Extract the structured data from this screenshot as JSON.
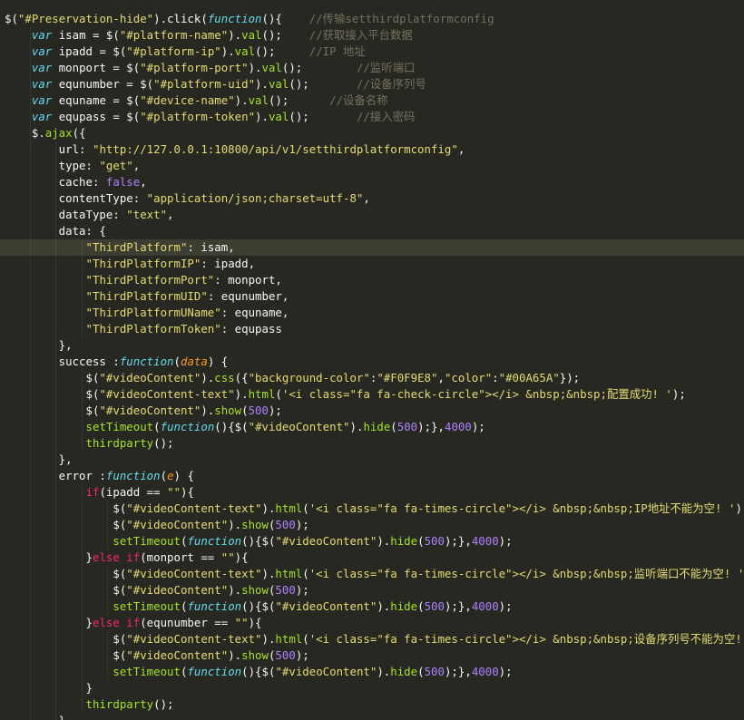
{
  "colors": {
    "background": "#272822",
    "current_line": "#3e3d32",
    "plain": "#f8f8f2",
    "string": "#e6db74",
    "keyword_italic": "#66d9ef",
    "function_call": "#a6e22e",
    "comment": "#75715e",
    "number": "#ae81ff",
    "control": "#f92672",
    "parameter": "#fd971f"
  },
  "code": {
    "current_line_index": 14,
    "lines": [
      [
        [
          "p",
          "$("
        ],
        [
          "s",
          "\"#Preservation-hide\""
        ],
        [
          "p",
          ").click("
        ],
        [
          "k",
          "function"
        ],
        [
          "p",
          "(){    "
        ],
        [
          "c",
          "//传输setthirdplatformconfig"
        ]
      ],
      [
        [
          "p",
          "    "
        ],
        [
          "k",
          "var"
        ],
        [
          "p",
          " isam = $("
        ],
        [
          "s",
          "\"#platform-name\""
        ],
        [
          "p",
          ")."
        ],
        [
          "f",
          "val"
        ],
        [
          "p",
          "();    "
        ],
        [
          "c",
          "//获取接入平台数据"
        ]
      ],
      [
        [
          "p",
          "    "
        ],
        [
          "k",
          "var"
        ],
        [
          "p",
          " ipadd = $("
        ],
        [
          "s",
          "\"#platform-ip\""
        ],
        [
          "p",
          ")."
        ],
        [
          "f",
          "val"
        ],
        [
          "p",
          "();     "
        ],
        [
          "c",
          "//IP 地址"
        ]
      ],
      [
        [
          "p",
          "    "
        ],
        [
          "k",
          "var"
        ],
        [
          "p",
          " monport = $("
        ],
        [
          "s",
          "\"#platform-port\""
        ],
        [
          "p",
          ")."
        ],
        [
          "f",
          "val"
        ],
        [
          "p",
          "();        "
        ],
        [
          "c",
          "//监听端口"
        ]
      ],
      [
        [
          "p",
          "    "
        ],
        [
          "k",
          "var"
        ],
        [
          "p",
          " equnumber = $("
        ],
        [
          "s",
          "\"#platform-uid\""
        ],
        [
          "p",
          ")."
        ],
        [
          "f",
          "val"
        ],
        [
          "p",
          "();       "
        ],
        [
          "c",
          "//设备序列号"
        ]
      ],
      [
        [
          "p",
          "    "
        ],
        [
          "k",
          "var"
        ],
        [
          "p",
          " equname = $("
        ],
        [
          "s",
          "\"#device-name\""
        ],
        [
          "p",
          ")."
        ],
        [
          "f",
          "val"
        ],
        [
          "p",
          "();      "
        ],
        [
          "c",
          "//设备名称"
        ]
      ],
      [
        [
          "p",
          "    "
        ],
        [
          "k",
          "var"
        ],
        [
          "p",
          " equpass = $("
        ],
        [
          "s",
          "\"#platform-token\""
        ],
        [
          "p",
          ")."
        ],
        [
          "f",
          "val"
        ],
        [
          "p",
          "();       "
        ],
        [
          "c",
          "//接入密码"
        ]
      ],
      [
        [
          "p",
          "    $."
        ],
        [
          "f",
          "ajax"
        ],
        [
          "p",
          "({"
        ]
      ],
      [
        [
          "p",
          "        url: "
        ],
        [
          "s",
          "\"http://127.0.0.1:10800/api/v1/setthirdplatformconfig\""
        ],
        [
          "p",
          ","
        ]
      ],
      [
        [
          "p",
          "        type: "
        ],
        [
          "s",
          "\"get\""
        ],
        [
          "p",
          ","
        ]
      ],
      [
        [
          "p",
          "        cache: "
        ],
        [
          "n",
          "false"
        ],
        [
          "p",
          ","
        ]
      ],
      [
        [
          "p",
          "        contentType: "
        ],
        [
          "s",
          "\"application/json;charset=utf-8\""
        ],
        [
          "p",
          ","
        ]
      ],
      [
        [
          "p",
          "        dataType: "
        ],
        [
          "s",
          "\"text\""
        ],
        [
          "p",
          ","
        ]
      ],
      [
        [
          "p",
          "        data: {"
        ]
      ],
      [
        [
          "p",
          "            "
        ],
        [
          "s",
          "\"ThirdPlatform\""
        ],
        [
          "p",
          ": isam,"
        ]
      ],
      [
        [
          "p",
          "            "
        ],
        [
          "s",
          "\"ThirdPlatformIP\""
        ],
        [
          "p",
          ": ipadd,"
        ]
      ],
      [
        [
          "p",
          "            "
        ],
        [
          "s",
          "\"ThirdPlatformPort\""
        ],
        [
          "p",
          ": monport,"
        ]
      ],
      [
        [
          "p",
          "            "
        ],
        [
          "s",
          "\"ThirdPlatformUID\""
        ],
        [
          "p",
          ": equnumber,"
        ]
      ],
      [
        [
          "p",
          "            "
        ],
        [
          "s",
          "\"ThirdPlatformUName\""
        ],
        [
          "p",
          ": equname,"
        ]
      ],
      [
        [
          "p",
          "            "
        ],
        [
          "s",
          "\"ThirdPlatformToken\""
        ],
        [
          "p",
          ": equpass"
        ]
      ],
      [
        [
          "p",
          "        },"
        ]
      ],
      [
        [
          "p",
          "        success :"
        ],
        [
          "k",
          "function"
        ],
        [
          "p",
          "("
        ],
        [
          "a",
          "data"
        ],
        [
          "p",
          ") {"
        ]
      ],
      [
        [
          "p",
          "            $("
        ],
        [
          "s",
          "\"#videoContent\""
        ],
        [
          "p",
          ")."
        ],
        [
          "f",
          "css"
        ],
        [
          "p",
          "({"
        ],
        [
          "s",
          "\"background-color\""
        ],
        [
          "p",
          ":"
        ],
        [
          "s",
          "\"#F0F9E8\""
        ],
        [
          "p",
          ","
        ],
        [
          "s",
          "\"color\""
        ],
        [
          "p",
          ":"
        ],
        [
          "s",
          "\"#00A65A\""
        ],
        [
          "p",
          "});"
        ]
      ],
      [
        [
          "p",
          "            $("
        ],
        [
          "s",
          "\"#videoContent-text\""
        ],
        [
          "p",
          ")."
        ],
        [
          "f",
          "html"
        ],
        [
          "p",
          "("
        ],
        [
          "s",
          "'<i class=\"fa fa-check-circle\"></i> &nbsp;&nbsp;配置成功! '"
        ],
        [
          "p",
          ");"
        ]
      ],
      [
        [
          "p",
          "            $("
        ],
        [
          "s",
          "\"#videoContent\""
        ],
        [
          "p",
          ")."
        ],
        [
          "f",
          "show"
        ],
        [
          "p",
          "("
        ],
        [
          "n",
          "500"
        ],
        [
          "p",
          ");"
        ]
      ],
      [
        [
          "p",
          "            "
        ],
        [
          "f",
          "setTimeout"
        ],
        [
          "p",
          "("
        ],
        [
          "k",
          "function"
        ],
        [
          "p",
          "(){$("
        ],
        [
          "s",
          "\"#videoContent\""
        ],
        [
          "p",
          ")."
        ],
        [
          "f",
          "hide"
        ],
        [
          "p",
          "("
        ],
        [
          "n",
          "500"
        ],
        [
          "p",
          ");},"
        ],
        [
          "n",
          "4000"
        ],
        [
          "p",
          ");"
        ]
      ],
      [
        [
          "p",
          "            "
        ],
        [
          "f",
          "thirdparty"
        ],
        [
          "p",
          "();"
        ]
      ],
      [
        [
          "p",
          "        },"
        ]
      ],
      [
        [
          "p",
          "        error :"
        ],
        [
          "k",
          "function"
        ],
        [
          "p",
          "("
        ],
        [
          "a",
          "e"
        ],
        [
          "p",
          ") {"
        ]
      ],
      [
        [
          "p",
          "            "
        ],
        [
          "r",
          "if"
        ],
        [
          "p",
          "(ipadd == "
        ],
        [
          "s",
          "\"\""
        ],
        [
          "p",
          "){"
        ]
      ],
      [
        [
          "p",
          "                $("
        ],
        [
          "s",
          "\"#videoContent-text\""
        ],
        [
          "p",
          ")."
        ],
        [
          "f",
          "html"
        ],
        [
          "p",
          "("
        ],
        [
          "s",
          "'<i class=\"fa fa-times-circle\"></i> &nbsp;&nbsp;IP地址不能为空! '"
        ],
        [
          "p",
          ");"
        ]
      ],
      [
        [
          "p",
          "                $("
        ],
        [
          "s",
          "\"#videoContent\""
        ],
        [
          "p",
          ")."
        ],
        [
          "f",
          "show"
        ],
        [
          "p",
          "("
        ],
        [
          "n",
          "500"
        ],
        [
          "p",
          ");"
        ]
      ],
      [
        [
          "p",
          "                "
        ],
        [
          "f",
          "setTimeout"
        ],
        [
          "p",
          "("
        ],
        [
          "k",
          "function"
        ],
        [
          "p",
          "(){$("
        ],
        [
          "s",
          "\"#videoContent\""
        ],
        [
          "p",
          ")."
        ],
        [
          "f",
          "hide"
        ],
        [
          "p",
          "("
        ],
        [
          "n",
          "500"
        ],
        [
          "p",
          ");},"
        ],
        [
          "n",
          "4000"
        ],
        [
          "p",
          ");"
        ]
      ],
      [
        [
          "p",
          "            }"
        ],
        [
          "r",
          "else if"
        ],
        [
          "p",
          "(monport == "
        ],
        [
          "s",
          "\"\""
        ],
        [
          "p",
          "){"
        ]
      ],
      [
        [
          "p",
          "                $("
        ],
        [
          "s",
          "\"#videoContent-text\""
        ],
        [
          "p",
          ")."
        ],
        [
          "f",
          "html"
        ],
        [
          "p",
          "("
        ],
        [
          "s",
          "'<i class=\"fa fa-times-circle\"></i> &nbsp;&nbsp;监听端口不能为空! '"
        ],
        [
          "p",
          ");"
        ]
      ],
      [
        [
          "p",
          "                $("
        ],
        [
          "s",
          "\"#videoContent\""
        ],
        [
          "p",
          ")."
        ],
        [
          "f",
          "show"
        ],
        [
          "p",
          "("
        ],
        [
          "n",
          "500"
        ],
        [
          "p",
          ");"
        ]
      ],
      [
        [
          "p",
          "                "
        ],
        [
          "f",
          "setTimeout"
        ],
        [
          "p",
          "("
        ],
        [
          "k",
          "function"
        ],
        [
          "p",
          "(){$("
        ],
        [
          "s",
          "\"#videoContent\""
        ],
        [
          "p",
          ")."
        ],
        [
          "f",
          "hide"
        ],
        [
          "p",
          "("
        ],
        [
          "n",
          "500"
        ],
        [
          "p",
          ");},"
        ],
        [
          "n",
          "4000"
        ],
        [
          "p",
          ");"
        ]
      ],
      [
        [
          "p",
          "            }"
        ],
        [
          "r",
          "else if"
        ],
        [
          "p",
          "(equnumber == "
        ],
        [
          "s",
          "\"\""
        ],
        [
          "p",
          "){"
        ]
      ],
      [
        [
          "p",
          "                $("
        ],
        [
          "s",
          "\"#videoContent-text\""
        ],
        [
          "p",
          ")."
        ],
        [
          "f",
          "html"
        ],
        [
          "p",
          "("
        ],
        [
          "s",
          "'<i class=\"fa fa-times-circle\"></i> &nbsp;&nbsp;设备序列号不能为空! '"
        ],
        [
          "p",
          ");"
        ]
      ],
      [
        [
          "p",
          "                $("
        ],
        [
          "s",
          "\"#videoContent\""
        ],
        [
          "p",
          ")."
        ],
        [
          "f",
          "show"
        ],
        [
          "p",
          "("
        ],
        [
          "n",
          "500"
        ],
        [
          "p",
          ");"
        ]
      ],
      [
        [
          "p",
          "                "
        ],
        [
          "f",
          "setTimeout"
        ],
        [
          "p",
          "("
        ],
        [
          "k",
          "function"
        ],
        [
          "p",
          "(){$("
        ],
        [
          "s",
          "\"#videoContent\""
        ],
        [
          "p",
          ")."
        ],
        [
          "f",
          "hide"
        ],
        [
          "p",
          "("
        ],
        [
          "n",
          "500"
        ],
        [
          "p",
          ");},"
        ],
        [
          "n",
          "4000"
        ],
        [
          "p",
          ");"
        ]
      ],
      [
        [
          "p",
          "            }"
        ]
      ],
      [
        [
          "p",
          "            "
        ],
        [
          "f",
          "thirdparty"
        ],
        [
          "p",
          "();"
        ]
      ],
      [
        [
          "p",
          "        },"
        ]
      ]
    ]
  }
}
